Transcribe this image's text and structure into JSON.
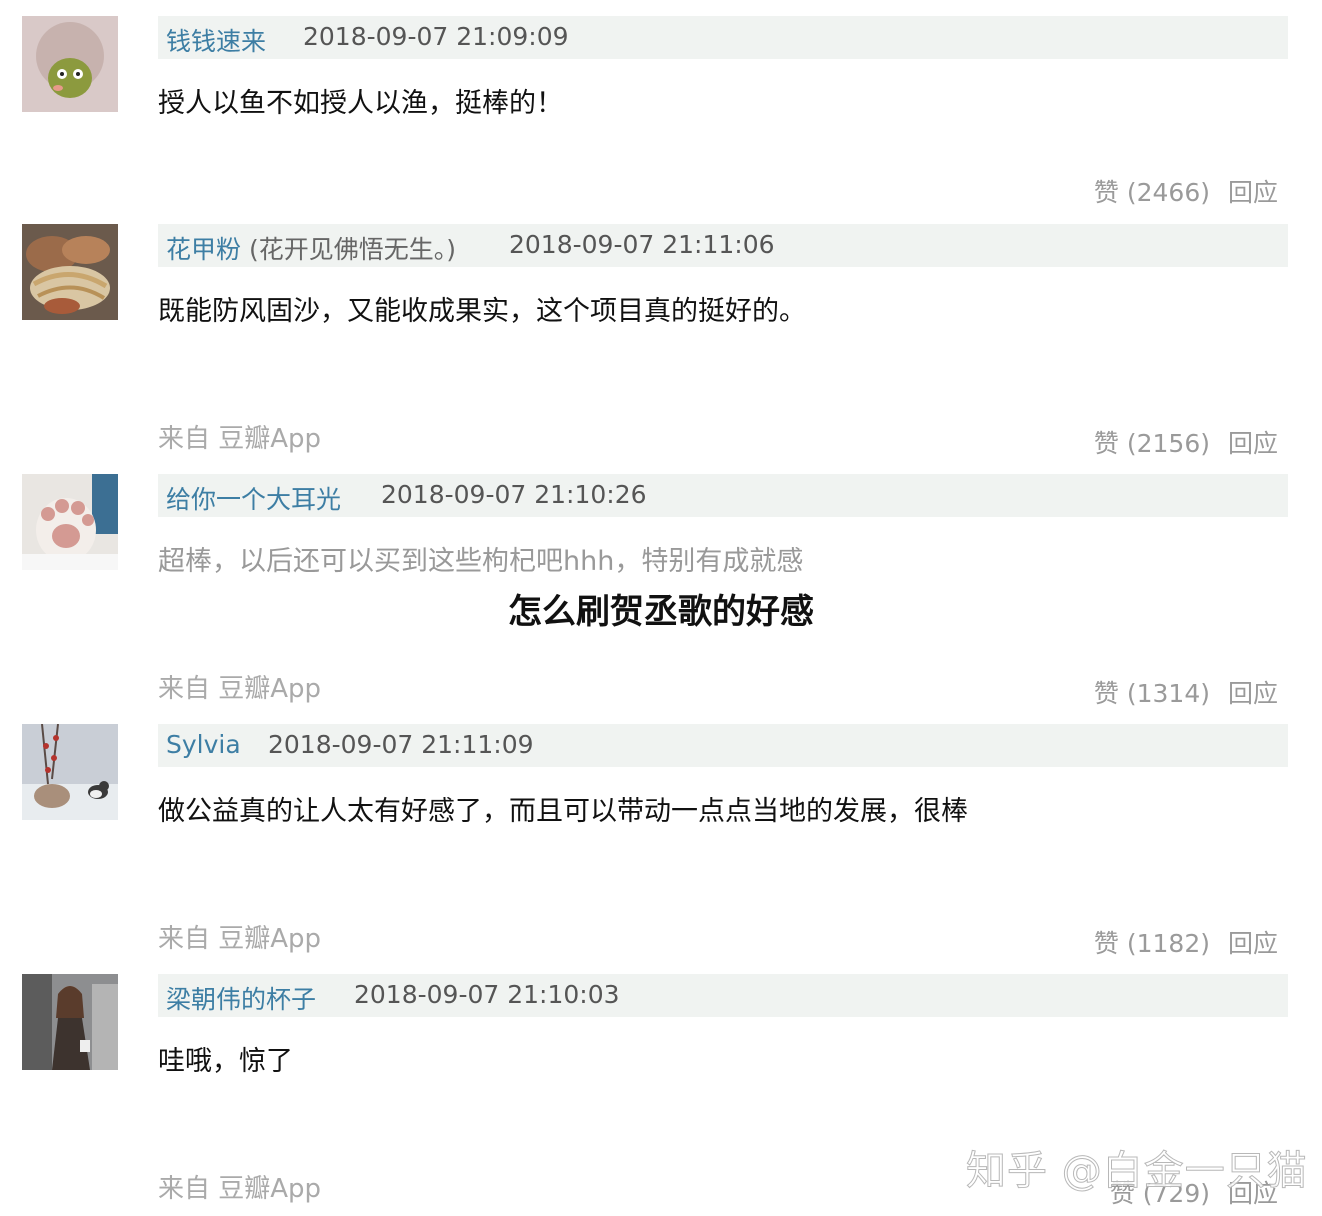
{
  "comments": [
    {
      "author": "钱钱速来",
      "alias": "",
      "timestamp": "2018-09-07 21:09:09",
      "content": "授人以鱼不如授人以渔，挺棒的！",
      "source": "",
      "likes": "赞 (2466)",
      "reply": "回应"
    },
    {
      "author": "花甲粉",
      "alias": "(花开见佛悟无生。)",
      "timestamp": "2018-09-07 21:11:06",
      "content": "既能防风固沙，又能收成果实，这个项目真的挺好的。",
      "source": "来自 豆瓣App",
      "likes": "赞 (2156)",
      "reply": "回应"
    },
    {
      "author": "给你一个大耳光",
      "alias": "",
      "timestamp": "2018-09-07 21:10:26",
      "content": "超棒，以后还可以买到这些枸杞吧hhh，特别有成就感",
      "source": "来自 豆瓣App",
      "likes": "赞 (1314)",
      "reply": "回应"
    },
    {
      "author": "Sylvia",
      "alias": "",
      "timestamp": "2018-09-07 21:11:09",
      "content": "做公益真的让人太有好感了，而且可以带动一点点当地的发展，很棒",
      "source": "来自 豆瓣App",
      "likes": "赞 (1182)",
      "reply": "回应"
    },
    {
      "author": "梁朝伟的杯子",
      "alias": "",
      "timestamp": "2018-09-07 21:10:03",
      "content": "哇哦，惊了",
      "source": "来自 豆瓣App",
      "likes": "赞 (729)",
      "reply": "回应"
    }
  ],
  "overlay_title": "怎么刷贺丞歌的好感",
  "watermark": "知乎 @白金一只猫",
  "colors": {
    "author_link": "#3d7ea4",
    "meta_bar_bg": "#f0f3f1",
    "muted_text": "#9a9a9a"
  }
}
